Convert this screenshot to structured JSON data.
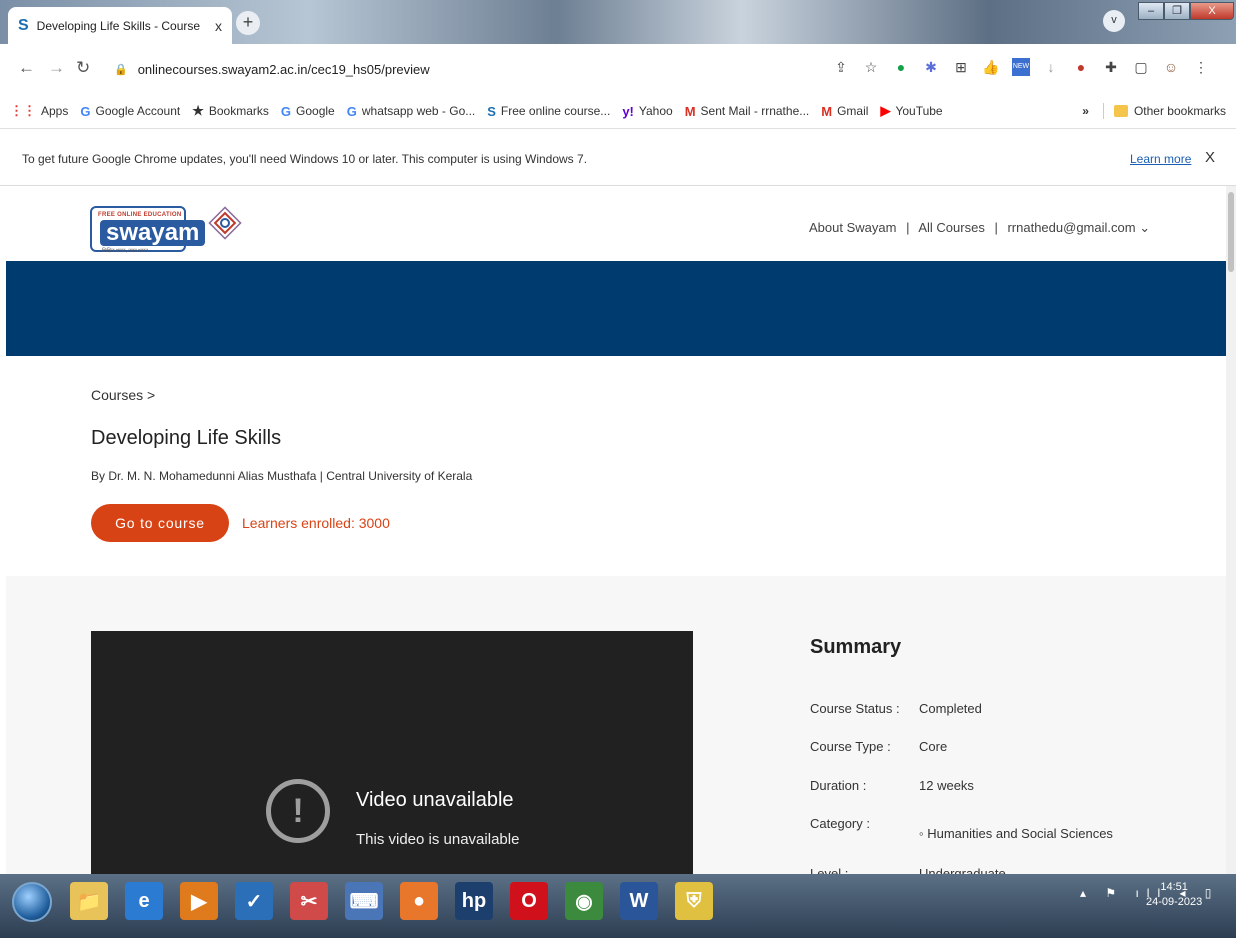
{
  "browser": {
    "tab_title": "Developing Life Skills - Course",
    "tab_favicon": "S",
    "tab_close": "x",
    "new_tab": "+",
    "tab_search": "v",
    "window_buttons": [
      "–",
      "❐",
      "X"
    ],
    "url": "onlinecourses.swayam2.ac.in/cec19_hs05/preview",
    "extension_badge": "NEW"
  },
  "bookmarks": {
    "items": [
      {
        "icon": "apps-grid-icon",
        "glyph": "⋮⋮",
        "color": "#e53935",
        "label": "Apps"
      },
      {
        "icon": "google-icon",
        "glyph": "G",
        "color": "#4285f4",
        "label": "Google Account"
      },
      {
        "icon": "star-icon",
        "glyph": "★",
        "color": "#333333",
        "label": "Bookmarks"
      },
      {
        "icon": "google-icon",
        "glyph": "G",
        "color": "#4285f4",
        "label": "Google"
      },
      {
        "icon": "google-icon",
        "glyph": "G",
        "color": "#4285f4",
        "label": "whatsapp web - Go..."
      },
      {
        "icon": "swayam-icon",
        "glyph": "S",
        "color": "#1a6fb5",
        "label": "Free online course..."
      },
      {
        "icon": "yahoo-icon",
        "glyph": "y!",
        "color": "#6001d2",
        "label": "Yahoo"
      },
      {
        "icon": "gmail-icon",
        "glyph": "M",
        "color": "#d93025",
        "label": "Sent Mail - rrnathe..."
      },
      {
        "icon": "gmail-icon",
        "glyph": "M",
        "color": "#d93025",
        "label": "Gmail"
      },
      {
        "icon": "youtube-icon",
        "glyph": "▶",
        "color": "#ff0000",
        "label": "YouTube"
      }
    ],
    "overflow": "»",
    "other": "Other bookmarks"
  },
  "infobar": {
    "message": "To get future Google Chrome updates, you'll need Windows 10 or later. This computer is using Windows 7.",
    "link": "Learn more",
    "close": "X"
  },
  "site": {
    "logo_tagline": "FREE ONLINE EDUCATION",
    "logo_word": "swayam",
    "logo_subtext": "शिक्षित भारत, उन्नत भारत",
    "nav": [
      "About Swayam",
      "All Courses",
      "rrnathedu@gmail.com"
    ],
    "separator": "|",
    "nav_chevron": "⌄",
    "banner_color": "#003b6f"
  },
  "course": {
    "breadcrumb": "Courses >",
    "title": "Developing Life Skills",
    "byline": "By Dr. M. N. Mohamedunni Alias Musthafa  |  Central University of Kerala",
    "cta": "Go to course",
    "enrolled": "Learners enrolled: 3000",
    "accent": "#d84315"
  },
  "video": {
    "icon": "!",
    "title": "Video unavailable",
    "subtitle": "This video is unavailable"
  },
  "summary": {
    "title": "Summary",
    "rows": [
      {
        "key": "Course Status :",
        "value": "Completed"
      },
      {
        "key": "Course Type :",
        "value": "Core"
      },
      {
        "key": "Duration :",
        "value": "12 weeks"
      },
      {
        "key": "Category :",
        "value": "◦  Humanities and Social Sciences"
      },
      {
        "key": "Level :",
        "value": "Undergraduate"
      }
    ]
  },
  "taskbar": {
    "apps": [
      {
        "name": "explorer-icon",
        "glyph": "📁",
        "bg": "#e7c35a"
      },
      {
        "name": "ie-icon",
        "glyph": "e",
        "bg": "#2b7bd3"
      },
      {
        "name": "media-icon",
        "glyph": "▶",
        "bg": "#e07b1d"
      },
      {
        "name": "checkmark-app-icon",
        "glyph": "✓",
        "bg": "#2b6fb8"
      },
      {
        "name": "snipping-tool-icon",
        "glyph": "✂",
        "bg": "#d04a4a"
      },
      {
        "name": "keyboard-app-icon",
        "glyph": "⌨",
        "bg": "#4a76b8"
      },
      {
        "name": "firefox-icon",
        "glyph": "●",
        "bg": "#e8762b"
      },
      {
        "name": "hp-icon",
        "glyph": "hp",
        "bg": "#1d3f6e"
      },
      {
        "name": "opera-icon",
        "glyph": "O",
        "bg": "#d0111b"
      },
      {
        "name": "chrome-icon",
        "glyph": "◉",
        "bg": "#3b8a3e"
      },
      {
        "name": "word-icon",
        "glyph": "W",
        "bg": "#2a5699"
      },
      {
        "name": "security-shield-icon",
        "glyph": "⛨",
        "bg": "#e0c040"
      }
    ],
    "time": "14:51",
    "date": "24-09-2023"
  }
}
